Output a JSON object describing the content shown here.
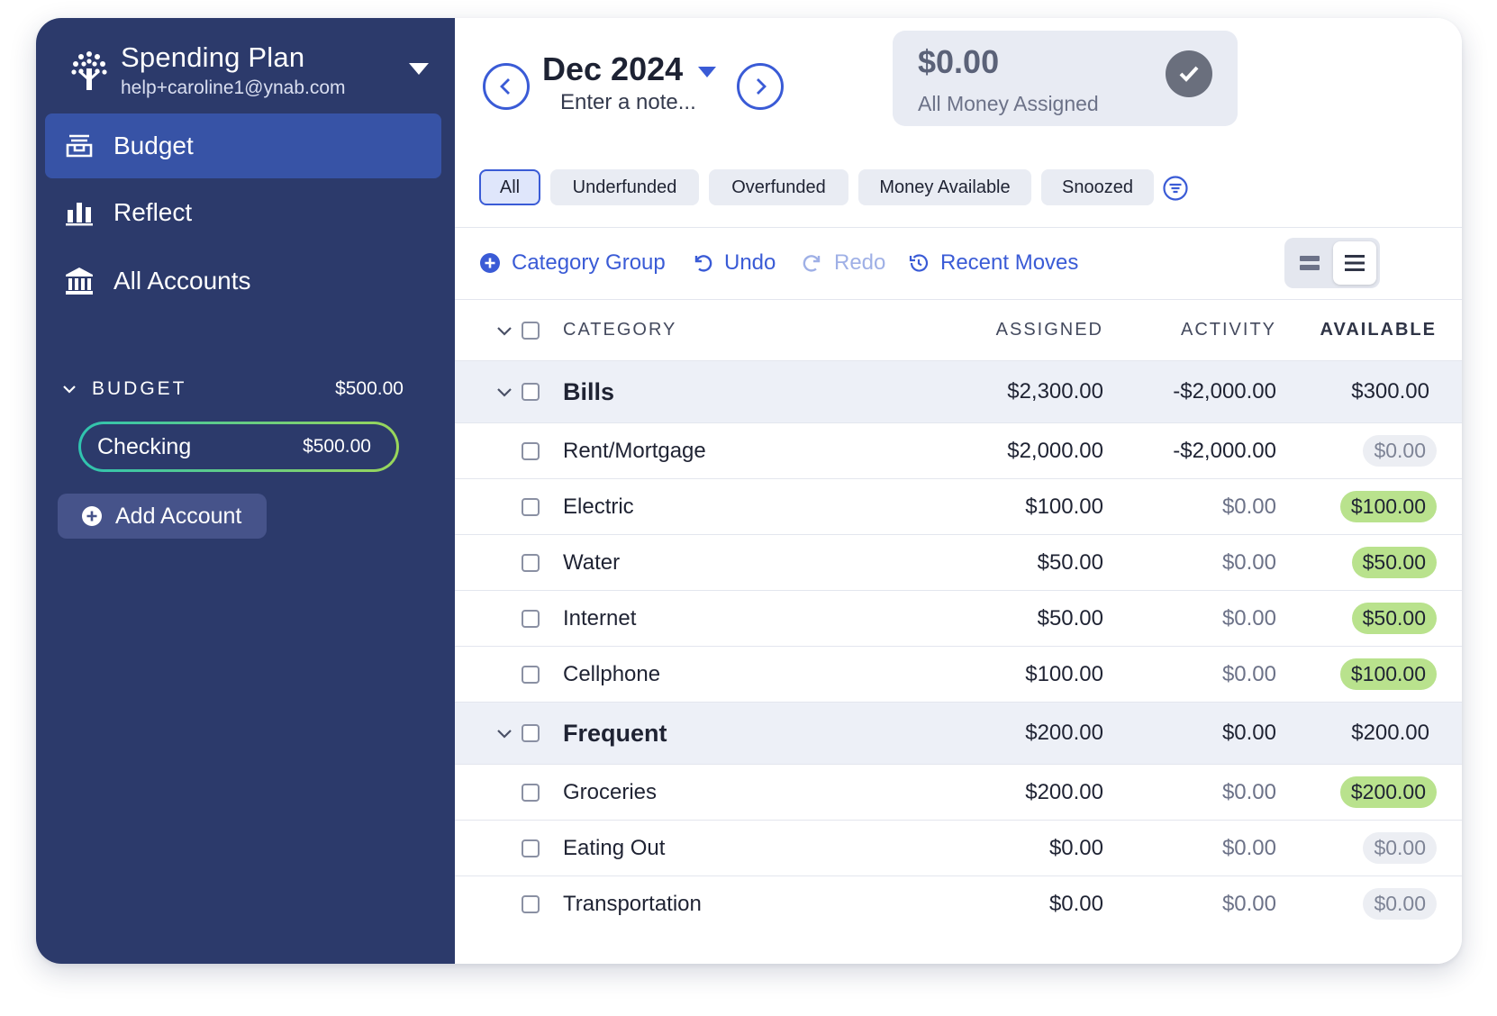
{
  "sidebar": {
    "plan_name": "Spending Plan",
    "email": "help+caroline1@ynab.com",
    "nav": [
      {
        "label": "Budget",
        "icon": "budget-icon",
        "active": true
      },
      {
        "label": "Reflect",
        "icon": "bar-chart-icon",
        "active": false
      },
      {
        "label": "All Accounts",
        "icon": "bank-icon",
        "active": false
      }
    ],
    "section": {
      "label": "BUDGET",
      "amount": "$500.00"
    },
    "account": {
      "name": "Checking",
      "amount": "$500.00"
    },
    "add_account_label": "Add Account"
  },
  "header": {
    "month": "Dec 2024",
    "note_placeholder": "Enter a note...",
    "assigned_amount": "$0.00",
    "assigned_label": "All Money Assigned"
  },
  "filters": [
    {
      "label": "All",
      "active": true
    },
    {
      "label": "Underfunded",
      "active": false
    },
    {
      "label": "Overfunded",
      "active": false
    },
    {
      "label": "Money Available",
      "active": false
    },
    {
      "label": "Snoozed",
      "active": false
    }
  ],
  "toolbar": {
    "category_group": "Category Group",
    "undo": "Undo",
    "redo": "Redo",
    "recent_moves": "Recent Moves"
  },
  "table": {
    "columns": {
      "category": "CATEGORY",
      "assigned": "ASSIGNED",
      "activity": "ACTIVITY",
      "available": "AVAILABLE"
    },
    "rows": [
      {
        "type": "group",
        "name": "Bills",
        "assigned": "$2,300.00",
        "activity": "-$2,000.00",
        "available": "$300.00",
        "style": "plain"
      },
      {
        "type": "item",
        "name": "Rent/Mortgage",
        "assigned": "$2,000.00",
        "activity": "-$2,000.00",
        "available": "$0.00",
        "style": "gray"
      },
      {
        "type": "item",
        "name": "Electric",
        "assigned": "$100.00",
        "activity": "$0.00",
        "available": "$100.00",
        "style": "green"
      },
      {
        "type": "item",
        "name": "Water",
        "assigned": "$50.00",
        "activity": "$0.00",
        "available": "$50.00",
        "style": "green"
      },
      {
        "type": "item",
        "name": "Internet",
        "assigned": "$50.00",
        "activity": "$0.00",
        "available": "$50.00",
        "style": "green"
      },
      {
        "type": "item",
        "name": "Cellphone",
        "assigned": "$100.00",
        "activity": "$0.00",
        "available": "$100.00",
        "style": "green"
      },
      {
        "type": "group",
        "name": "Frequent",
        "assigned": "$200.00",
        "activity": "$0.00",
        "available": "$200.00",
        "style": "plain"
      },
      {
        "type": "item",
        "name": "Groceries",
        "assigned": "$200.00",
        "activity": "$0.00",
        "available": "$200.00",
        "style": "green"
      },
      {
        "type": "item",
        "name": "Eating Out",
        "assigned": "$0.00",
        "activity": "$0.00",
        "available": "$0.00",
        "style": "gray"
      },
      {
        "type": "item",
        "name": "Transportation",
        "assigned": "$0.00",
        "activity": "$0.00",
        "available": "$0.00",
        "style": "gray"
      }
    ]
  },
  "colors": {
    "sidebar_bg": "#2c3a6b",
    "active_nav": "#3753a6",
    "accent": "#3a5bd6",
    "available_green": "#b9e28d"
  }
}
